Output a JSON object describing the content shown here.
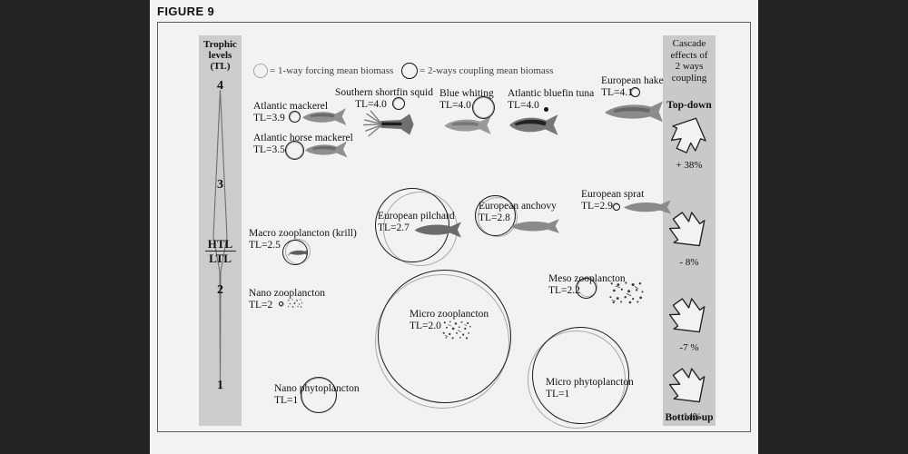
{
  "figure": {
    "label": "FIGURE 9"
  },
  "legend": {
    "one_way": {
      "icon": "gray-circle",
      "text": "= 1-way forcing mean biomass",
      "color": "#a5a5a5"
    },
    "two_way": {
      "icon": "black-circle",
      "text": "= 2-ways coupling mean biomass",
      "color": "#111111"
    }
  },
  "trophic_axis": {
    "title_line1": "Trophic",
    "title_line2": "levels",
    "title_line3": "(TL)",
    "levels": [
      "4",
      "3",
      "2",
      "1"
    ],
    "divider_upper": "HTL",
    "divider_lower": "LTL"
  },
  "cascade": {
    "title_line1": "Cascade",
    "title_line2": "effects of",
    "title_line3": "2 ways",
    "title_line4": "coupling",
    "top_label": "Top-down",
    "bottom_label": "Bottom-up",
    "effects": [
      {
        "direction": "up",
        "value": "+ 38%"
      },
      {
        "direction": "down",
        "value": "- 8%"
      },
      {
        "direction": "down",
        "value": "-7 %"
      },
      {
        "direction": "down",
        "value": "- 14%"
      }
    ]
  },
  "species": [
    {
      "id": "atlantic-mackerel",
      "name": "Atlantic mackerel",
      "tl": "TL=3.9",
      "icon": "fish-silhouette"
    },
    {
      "id": "atlantic-horse-mackerel",
      "name": "Atlantic horse mackerel",
      "tl": "TL=3.5",
      "icon": "fish-silhouette"
    },
    {
      "id": "southern-shortfin-squid",
      "name": "Southern shortfin squid",
      "tl": "TL=4.0",
      "icon": "squid-silhouette"
    },
    {
      "id": "blue-whiting",
      "name": "Blue whiting",
      "tl": "TL=4.0",
      "icon": "fish-silhouette"
    },
    {
      "id": "atlantic-bluefin-tuna",
      "name": "Atlantic bluefin tuna",
      "tl": "TL=4.0",
      "icon": "tuna-silhouette"
    },
    {
      "id": "european-hake",
      "name": "European hake",
      "tl": "TL=4.1",
      "icon": "fish-silhouette"
    },
    {
      "id": "european-pilchard",
      "name": "European pilchard",
      "tl": "TL=2.7",
      "icon": "fish-silhouette"
    },
    {
      "id": "european-anchovy",
      "name": "European anchovy",
      "tl": "TL=2.8",
      "icon": "fish-silhouette"
    },
    {
      "id": "european-sprat",
      "name": "European sprat",
      "tl": "TL=2.9",
      "icon": "fish-silhouette"
    },
    {
      "id": "macro-zooplancton",
      "name": "Macro zooplancton (krill)",
      "tl": "TL=2.5",
      "icon": "krill-silhouette"
    },
    {
      "id": "meso-zooplancton",
      "name": "Meso zooplancton",
      "tl": "TL=2.2",
      "icon": "plankton-texture"
    },
    {
      "id": "micro-zooplancton",
      "name": "Micro zooplancton",
      "tl": "TL=2.0",
      "icon": "plankton-texture"
    },
    {
      "id": "nano-zooplancton",
      "name": "Nano zooplancton",
      "tl": "TL=2",
      "icon": "plankton-texture"
    },
    {
      "id": "micro-phytoplancton",
      "name": "Micro phytoplancton",
      "tl": "TL=1",
      "icon": "none"
    },
    {
      "id": "nano-phytoplancton",
      "name": "Nano phytoplancton",
      "tl": "TL=1",
      "icon": "none"
    }
  ]
}
